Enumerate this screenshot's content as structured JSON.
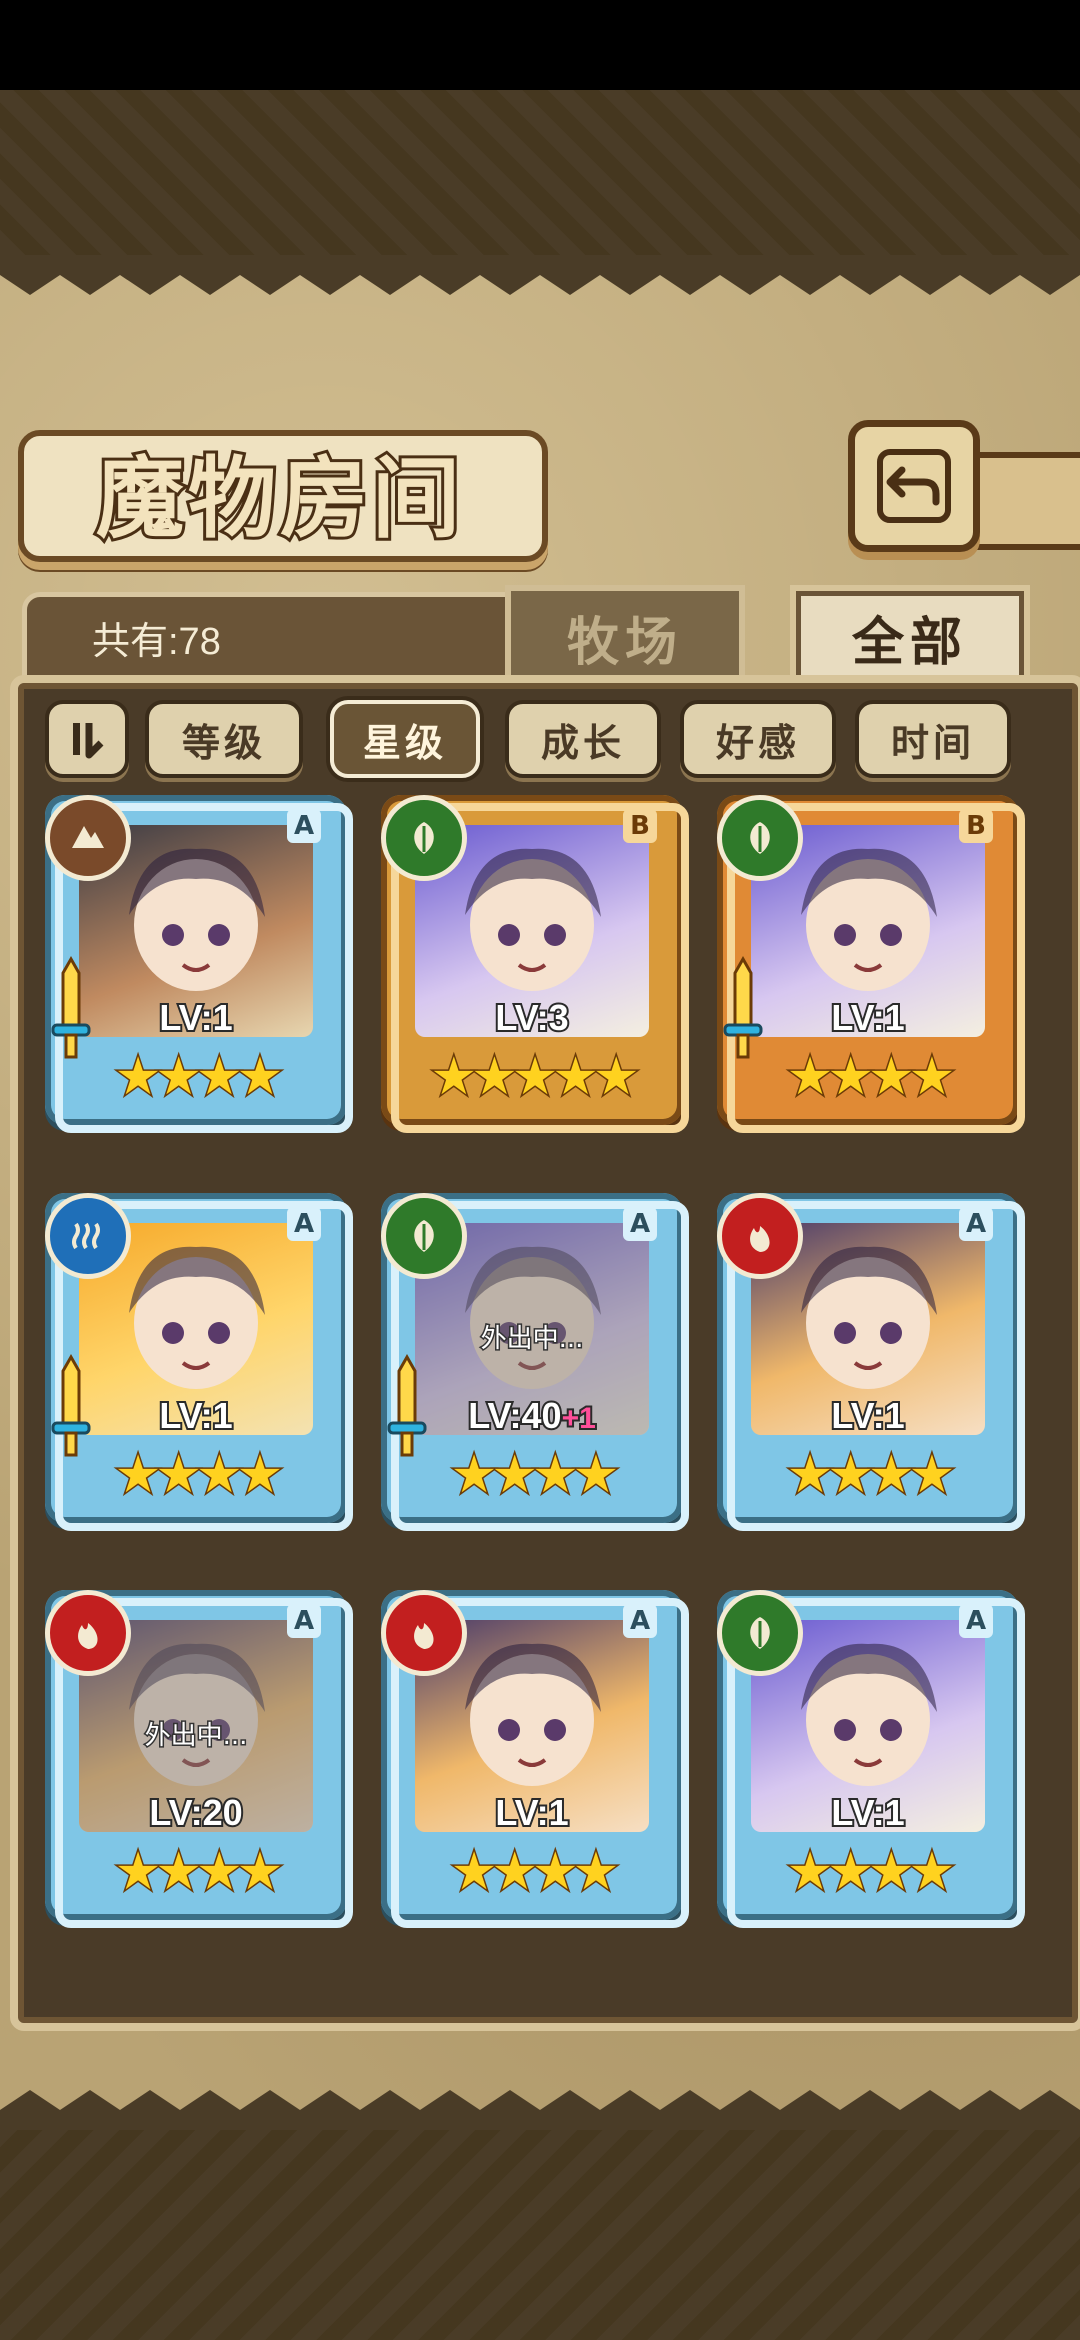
{
  "header": {
    "title": "魔物房间",
    "back_icon": "return-arrow-icon",
    "count_label": "共有:78"
  },
  "tabs": [
    {
      "label": "牧场",
      "active": false
    },
    {
      "label": "全部",
      "active": true
    }
  ],
  "sort": {
    "order_icon": "sort-order-icon",
    "options": [
      {
        "label": "等级",
        "active": false
      },
      {
        "label": "星级",
        "active": true
      },
      {
        "label": "成长",
        "active": false
      },
      {
        "label": "好感",
        "active": false
      },
      {
        "label": "时间",
        "active": false
      }
    ]
  },
  "monsters": [
    {
      "level": "LV:1",
      "plus": "",
      "stars": 4,
      "rank": "A",
      "element": "earth",
      "status": "",
      "equipped": true,
      "frame": "blue"
    },
    {
      "level": "LV:3",
      "plus": "",
      "stars": 5,
      "rank": "B",
      "element": "nature",
      "status": "",
      "equipped": false,
      "frame": "gold"
    },
    {
      "level": "LV:1",
      "plus": "",
      "stars": 4,
      "rank": "B",
      "element": "nature",
      "status": "",
      "equipped": true,
      "frame": "orange"
    },
    {
      "level": "LV:1",
      "plus": "",
      "stars": 4,
      "rank": "A",
      "element": "water",
      "status": "",
      "equipped": true,
      "frame": "blue"
    },
    {
      "level": "LV:40",
      "plus": "+1",
      "stars": 4,
      "rank": "A",
      "element": "nature",
      "status": "外出中...",
      "equipped": true,
      "frame": "blue"
    },
    {
      "level": "LV:1",
      "plus": "",
      "stars": 4,
      "rank": "A",
      "element": "fire",
      "status": "",
      "equipped": false,
      "frame": "blue"
    },
    {
      "level": "LV:20",
      "plus": "",
      "stars": 4,
      "rank": "A",
      "element": "fire",
      "status": "外出中...",
      "equipped": false,
      "frame": "blue"
    },
    {
      "level": "LV:1",
      "plus": "",
      "stars": 4,
      "rank": "A",
      "element": "fire",
      "status": "",
      "equipped": false,
      "frame": "blue"
    },
    {
      "level": "LV:1",
      "plus": "",
      "stars": 4,
      "rank": "A",
      "element": "nature",
      "status": "",
      "equipped": false,
      "frame": "blue"
    }
  ],
  "colors": {
    "earth": "#7a4a2a",
    "nature": "#2f7a2a",
    "water": "#1f6fb8",
    "fire": "#c21f1f",
    "frame_blue": "#7fc6e6",
    "frame_gold": "#d99a3a",
    "frame_orange": "#e08a35",
    "star": "#ffd21f"
  }
}
